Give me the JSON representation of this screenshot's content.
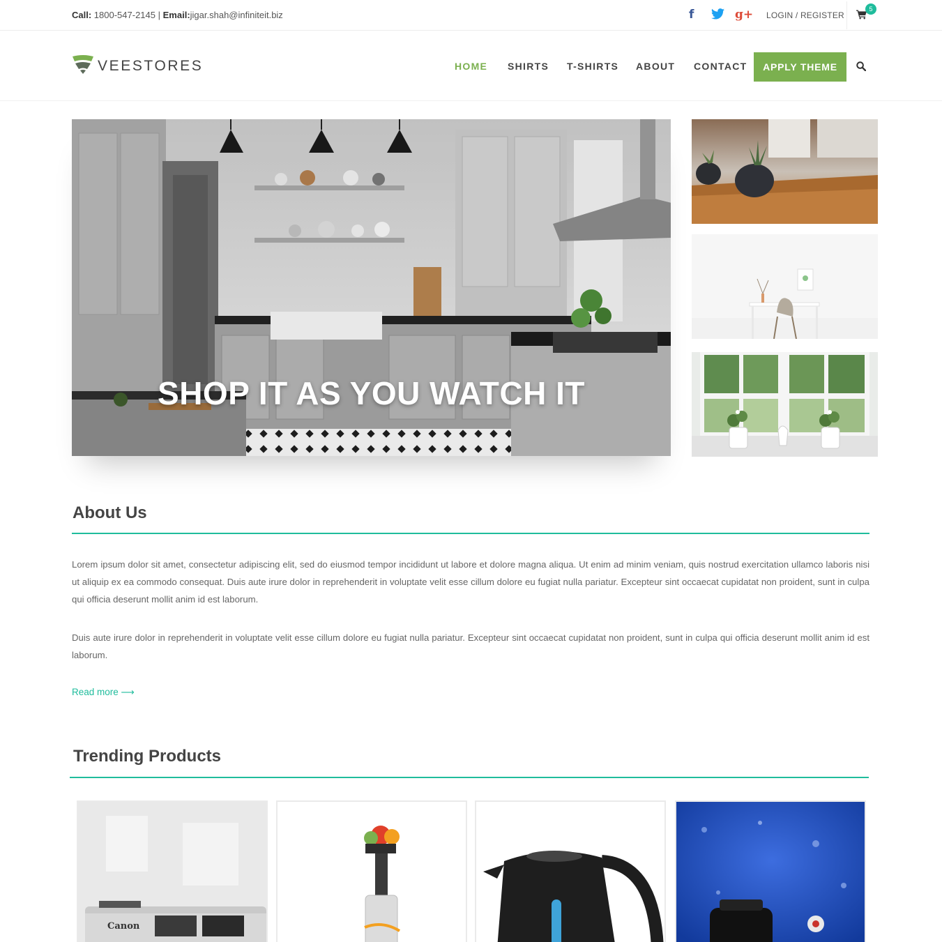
{
  "topbar": {
    "call_label": "Call:",
    "phone": "1800-547-2145",
    "divider": "|",
    "email_label": "Email:",
    "email": "jigar.shah@infiniteit.biz",
    "login_register": "LOGIN / REGISTER",
    "cart_count": "5",
    "social": [
      "facebook-icon",
      "twitter-icon",
      "google-plus-icon"
    ],
    "google_plus_glyph": "g+"
  },
  "brand": {
    "name": "VEESTORES",
    "colors": {
      "accent_green": "#7bb04f",
      "accent_teal": "#1fbc9c"
    }
  },
  "nav": {
    "items": [
      {
        "label": "HOME",
        "active": true
      },
      {
        "label": "SHIRTS",
        "active": false
      },
      {
        "label": "T-SHIRTS",
        "active": false
      },
      {
        "label": "ABOUT",
        "active": false
      },
      {
        "label": "CONTACT",
        "active": false
      }
    ],
    "apply_theme": "APPLY THEME"
  },
  "hero": {
    "caption": "SHOP IT AS YOU WATCH IT"
  },
  "about": {
    "title": "About Us",
    "paragraph1": "Lorem ipsum dolor sit amet, consectetur adipiscing elit, sed do eiusmod tempor incididunt ut labore et dolore magna aliqua. Ut enim ad minim veniam, quis nostrud exercitation ullamco laboris nisi ut aliquip ex ea commodo consequat. Duis aute irure dolor in reprehenderit in voluptate velit esse cillum dolore eu fugiat nulla pariatur. Excepteur sint occaecat cupidatat non proident, sunt in culpa qui officia deserunt mollit anim id est laborum.",
    "paragraph2": "Duis aute irure dolor in reprehenderit in voluptate velit esse cillum dolore eu fugiat nulla pariatur. Excepteur sint occaecat cupidatat non proident, sunt in culpa qui officia deserunt mollit anim id est laborum.",
    "read_more": "Read more ⟶"
  },
  "trending": {
    "title": "Trending Products",
    "products": [
      "camera-image",
      "juicer-image",
      "kettle-image",
      "perfume-image"
    ],
    "camera_brand": "Canon"
  }
}
